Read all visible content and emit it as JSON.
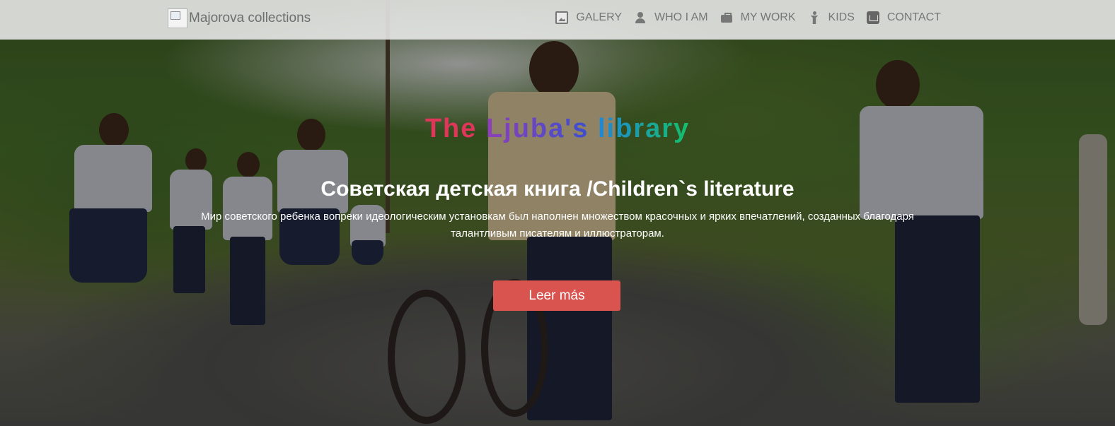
{
  "navbar": {
    "brand": "Majorova collections",
    "items": [
      {
        "label": "GALERY",
        "icon": "picture-icon"
      },
      {
        "label": "WHO I AM",
        "icon": "user-icon"
      },
      {
        "label": "MY WORK",
        "icon": "briefcase-icon"
      },
      {
        "label": "KIDS",
        "icon": "child-icon"
      },
      {
        "label": "CONTACT",
        "icon": "envelope-icon"
      }
    ]
  },
  "hero": {
    "title_words": [
      "The",
      "Ljuba's",
      "library"
    ],
    "heading": "Советская детская книга /Children`s literature",
    "lead": "Мир советского ребенка вопреки идеологическим установкам был наполнен множеством красочных и ярких впечатлений, созданных благодаря талантливым писателям и иллюстраторам.",
    "button_label": "Leer más"
  },
  "colors": {
    "title_colors": [
      "#e0365a",
      "#8f3fb8",
      "#1f86d8",
      "#14c06b"
    ],
    "button": "#d9534f",
    "navbar_bg": "#ebebeb"
  }
}
